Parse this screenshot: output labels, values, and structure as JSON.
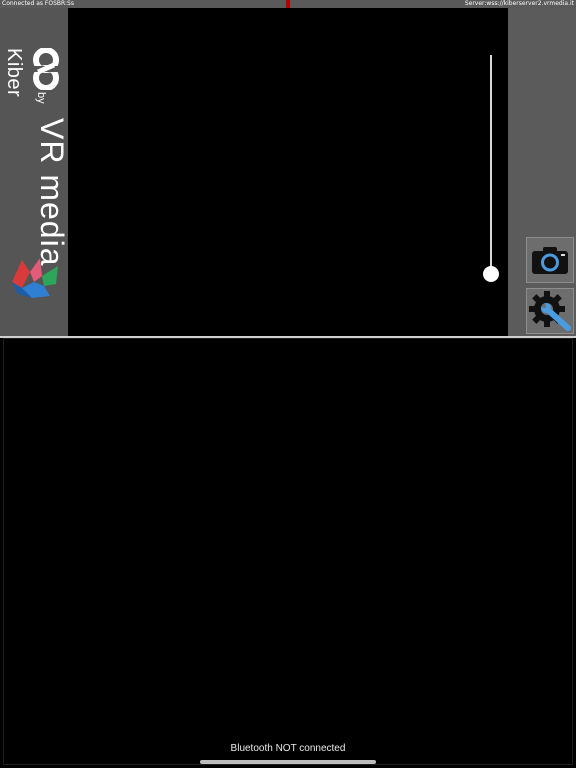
{
  "status_bar": {
    "left_text": "Connected as FOSBR:Ss",
    "right_text": "Server:wss://kiberserver2.vrmedia.it"
  },
  "branding": {
    "product": "Kiber",
    "by": "by",
    "company": "VR media"
  },
  "zoom": {
    "level": 0
  },
  "toolbar": {
    "camera_icon": "camera-icon",
    "settings_icon": "settings-wrench-icon"
  },
  "footer": {
    "bluetooth_status": "Bluetooth NOT connected"
  },
  "colors": {
    "sidebar": "#555555",
    "accent_blue": "#3f8fd6",
    "status_marker": "#b00000"
  }
}
